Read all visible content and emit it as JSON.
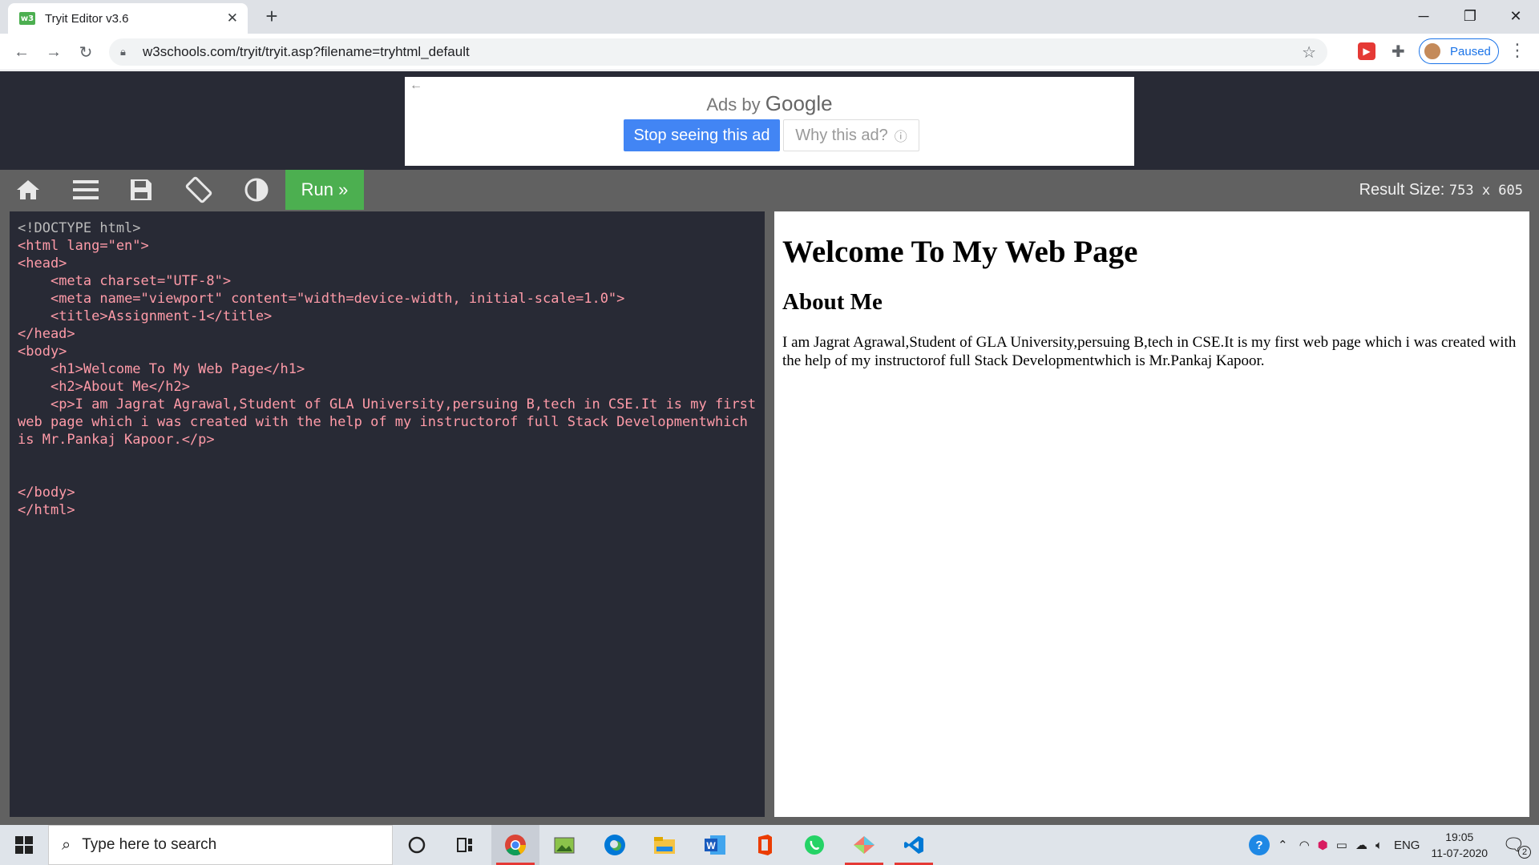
{
  "browser": {
    "tab_title": "Tryit Editor v3.6",
    "tab_favicon": "w3",
    "url": "w3schools.com/tryit/tryit.asp?filename=tryhtml_default",
    "profile_status": "Paused"
  },
  "ad": {
    "ads_by": "Ads by",
    "google": "Google",
    "stop_label": "Stop seeing this ad",
    "why_label": "Why this ad?"
  },
  "tryit": {
    "run_label": "Run »",
    "result_size_label": "Result Size:",
    "result_size_value": "753 x 605"
  },
  "code_lines": [
    "<!DOCTYPE html>",
    "<html lang=\"en\">",
    "<head>",
    "    <meta charset=\"UTF-8\">",
    "    <meta name=\"viewport\" content=\"width=device-width, initial-scale=1.0\">",
    "    <title>Assignment-1</title>",
    "</head>",
    "<body>",
    "    <h1>Welcome To My Web Page</h1>",
    "    <h2>About Me</h2>",
    "    <p>I am Jagrat Agrawal,Student of GLA University,persuing B,tech in CSE.It is my first web page which i was created with the help of my instructorof full Stack Developmentwhich is Mr.Pankaj Kapoor.</p>",
    "",
    "",
    "</body>",
    "</html>"
  ],
  "result": {
    "h1": "Welcome To My Web Page",
    "h2": "About Me",
    "p": "I am Jagrat Agrawal,Student of GLA University,persuing B,tech in CSE.It is my first web page which i was created with the help of my instructorof full Stack Developmentwhich is Mr.Pankaj Kapoor."
  },
  "taskbar": {
    "search_placeholder": "Type here to search",
    "language": "ENG",
    "time": "19:05",
    "date": "11-07-2020",
    "notification_count": "2"
  },
  "colors": {
    "w3_green": "#4caf50",
    "editor_bg": "#282a35",
    "toolbar_bg": "#616161",
    "ad_blue": "#4285f4"
  }
}
